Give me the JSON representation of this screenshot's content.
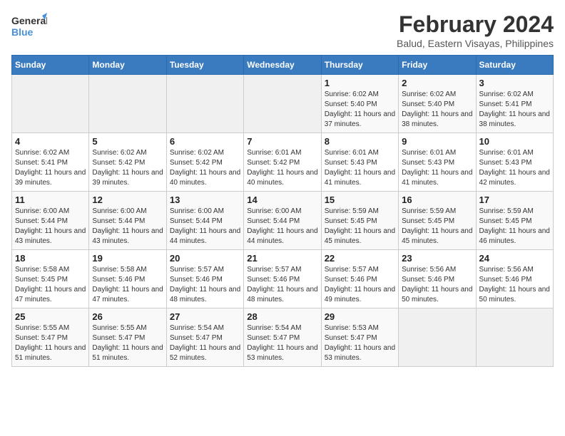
{
  "logo": {
    "line1": "General",
    "line2": "Blue"
  },
  "title": "February 2024",
  "location": "Balud, Eastern Visayas, Philippines",
  "days_header": [
    "Sunday",
    "Monday",
    "Tuesday",
    "Wednesday",
    "Thursday",
    "Friday",
    "Saturday"
  ],
  "weeks": [
    [
      {
        "day": "",
        "info": ""
      },
      {
        "day": "",
        "info": ""
      },
      {
        "day": "",
        "info": ""
      },
      {
        "day": "",
        "info": ""
      },
      {
        "day": "1",
        "info": "Sunrise: 6:02 AM\nSunset: 5:40 PM\nDaylight: 11 hours and 37 minutes."
      },
      {
        "day": "2",
        "info": "Sunrise: 6:02 AM\nSunset: 5:40 PM\nDaylight: 11 hours and 38 minutes."
      },
      {
        "day": "3",
        "info": "Sunrise: 6:02 AM\nSunset: 5:41 PM\nDaylight: 11 hours and 38 minutes."
      }
    ],
    [
      {
        "day": "4",
        "info": "Sunrise: 6:02 AM\nSunset: 5:41 PM\nDaylight: 11 hours and 39 minutes."
      },
      {
        "day": "5",
        "info": "Sunrise: 6:02 AM\nSunset: 5:42 PM\nDaylight: 11 hours and 39 minutes."
      },
      {
        "day": "6",
        "info": "Sunrise: 6:02 AM\nSunset: 5:42 PM\nDaylight: 11 hours and 40 minutes."
      },
      {
        "day": "7",
        "info": "Sunrise: 6:01 AM\nSunset: 5:42 PM\nDaylight: 11 hours and 40 minutes."
      },
      {
        "day": "8",
        "info": "Sunrise: 6:01 AM\nSunset: 5:43 PM\nDaylight: 11 hours and 41 minutes."
      },
      {
        "day": "9",
        "info": "Sunrise: 6:01 AM\nSunset: 5:43 PM\nDaylight: 11 hours and 41 minutes."
      },
      {
        "day": "10",
        "info": "Sunrise: 6:01 AM\nSunset: 5:43 PM\nDaylight: 11 hours and 42 minutes."
      }
    ],
    [
      {
        "day": "11",
        "info": "Sunrise: 6:00 AM\nSunset: 5:44 PM\nDaylight: 11 hours and 43 minutes."
      },
      {
        "day": "12",
        "info": "Sunrise: 6:00 AM\nSunset: 5:44 PM\nDaylight: 11 hours and 43 minutes."
      },
      {
        "day": "13",
        "info": "Sunrise: 6:00 AM\nSunset: 5:44 PM\nDaylight: 11 hours and 44 minutes."
      },
      {
        "day": "14",
        "info": "Sunrise: 6:00 AM\nSunset: 5:44 PM\nDaylight: 11 hours and 44 minutes."
      },
      {
        "day": "15",
        "info": "Sunrise: 5:59 AM\nSunset: 5:45 PM\nDaylight: 11 hours and 45 minutes."
      },
      {
        "day": "16",
        "info": "Sunrise: 5:59 AM\nSunset: 5:45 PM\nDaylight: 11 hours and 45 minutes."
      },
      {
        "day": "17",
        "info": "Sunrise: 5:59 AM\nSunset: 5:45 PM\nDaylight: 11 hours and 46 minutes."
      }
    ],
    [
      {
        "day": "18",
        "info": "Sunrise: 5:58 AM\nSunset: 5:45 PM\nDaylight: 11 hours and 47 minutes."
      },
      {
        "day": "19",
        "info": "Sunrise: 5:58 AM\nSunset: 5:46 PM\nDaylight: 11 hours and 47 minutes."
      },
      {
        "day": "20",
        "info": "Sunrise: 5:57 AM\nSunset: 5:46 PM\nDaylight: 11 hours and 48 minutes."
      },
      {
        "day": "21",
        "info": "Sunrise: 5:57 AM\nSunset: 5:46 PM\nDaylight: 11 hours and 48 minutes."
      },
      {
        "day": "22",
        "info": "Sunrise: 5:57 AM\nSunset: 5:46 PM\nDaylight: 11 hours and 49 minutes."
      },
      {
        "day": "23",
        "info": "Sunrise: 5:56 AM\nSunset: 5:46 PM\nDaylight: 11 hours and 50 minutes."
      },
      {
        "day": "24",
        "info": "Sunrise: 5:56 AM\nSunset: 5:46 PM\nDaylight: 11 hours and 50 minutes."
      }
    ],
    [
      {
        "day": "25",
        "info": "Sunrise: 5:55 AM\nSunset: 5:47 PM\nDaylight: 11 hours and 51 minutes."
      },
      {
        "day": "26",
        "info": "Sunrise: 5:55 AM\nSunset: 5:47 PM\nDaylight: 11 hours and 51 minutes."
      },
      {
        "day": "27",
        "info": "Sunrise: 5:54 AM\nSunset: 5:47 PM\nDaylight: 11 hours and 52 minutes."
      },
      {
        "day": "28",
        "info": "Sunrise: 5:54 AM\nSunset: 5:47 PM\nDaylight: 11 hours and 53 minutes."
      },
      {
        "day": "29",
        "info": "Sunrise: 5:53 AM\nSunset: 5:47 PM\nDaylight: 11 hours and 53 minutes."
      },
      {
        "day": "",
        "info": ""
      },
      {
        "day": "",
        "info": ""
      }
    ]
  ]
}
